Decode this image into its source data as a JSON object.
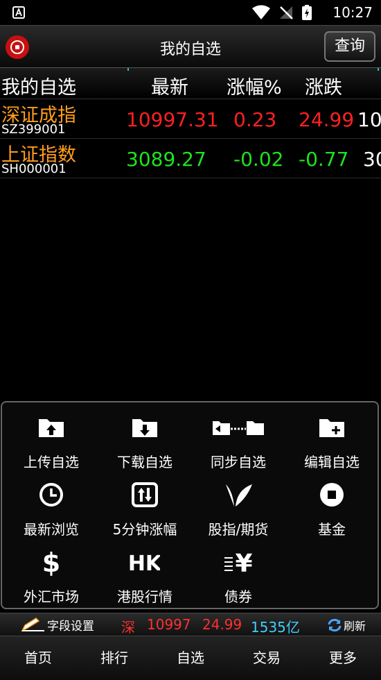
{
  "status": {
    "time": "10:27"
  },
  "titlebar": {
    "title": "我的自选",
    "query_label": "查询"
  },
  "table": {
    "headers": {
      "name": "我的自选",
      "latest": "最新",
      "pct": "涨幅%",
      "change": "涨跌"
    },
    "rows": [
      {
        "name": "深证成指",
        "code": "SZ399001",
        "latest": "10997.31",
        "pct": "0.23",
        "change": "24.99",
        "extra": "10",
        "trend": "up"
      },
      {
        "name": "上证指数",
        "code": "SH000001",
        "latest": "3089.27",
        "pct": "-0.02",
        "change": "-0.77",
        "extra": "30",
        "trend": "down"
      }
    ]
  },
  "menu": {
    "items": [
      {
        "label": "上传自选",
        "icon": "folder-upload-icon"
      },
      {
        "label": "下载自选",
        "icon": "folder-download-icon"
      },
      {
        "label": "同步自选",
        "icon": "folder-sync-icon"
      },
      {
        "label": "编辑自选",
        "icon": "folder-add-icon"
      },
      {
        "label": "最新浏览",
        "icon": "clock-icon"
      },
      {
        "label": "5分钟涨幅",
        "icon": "updown-arrows-icon"
      },
      {
        "label": "股指/期货",
        "icon": "leaf-icon"
      },
      {
        "label": "基金",
        "icon": "stop-circle-icon"
      },
      {
        "label": "外汇市场",
        "icon": "dollar-icon"
      },
      {
        "label": "港股行情",
        "icon": "hk-icon"
      },
      {
        "label": "债券",
        "icon": "yen-icon"
      }
    ]
  },
  "strip": {
    "field_settings": "字段设置",
    "market": "深",
    "index": "10997",
    "change": "24.99",
    "amount": "1535亿",
    "refresh": "刷新"
  },
  "nav": [
    "首页",
    "排行",
    "自选",
    "交易",
    "更多"
  ],
  "colors": {
    "up": "#ff2020",
    "down": "#1fe21f",
    "stock_name": "#ff9e1b",
    "amount": "#3fd0ff",
    "logo": "#c81010"
  }
}
